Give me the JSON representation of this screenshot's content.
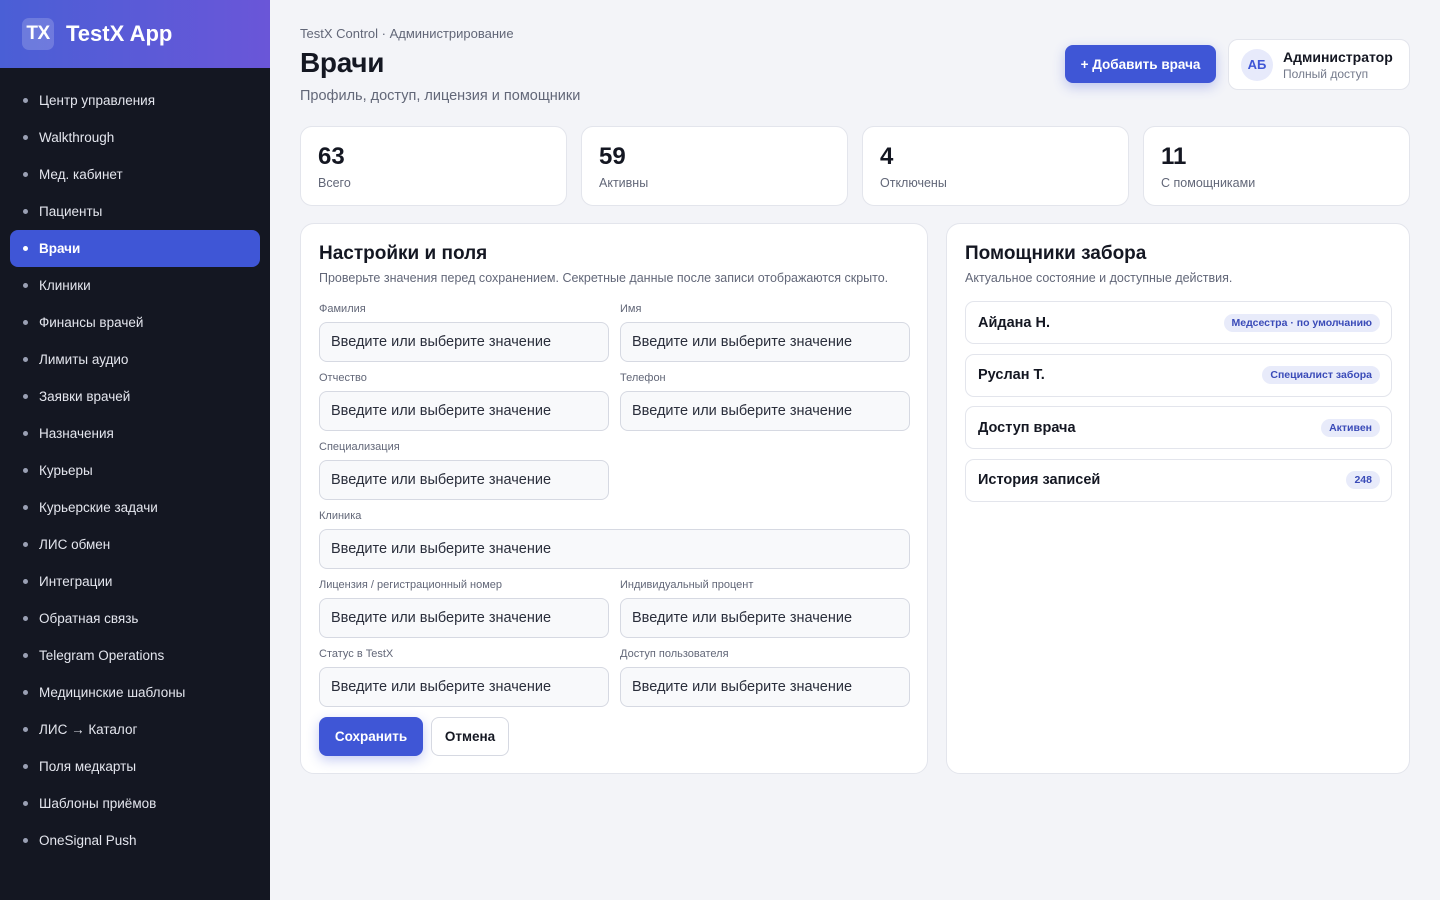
{
  "brand": {
    "logo": "TX",
    "name": "TestX App"
  },
  "sidebar": {
    "items": [
      {
        "label": "Центр управления"
      },
      {
        "label": "Walkthrough"
      },
      {
        "label": "Мед. кабинет"
      },
      {
        "label": "Пациенты"
      },
      {
        "label": "Врачи",
        "active": true
      },
      {
        "label": "Клиники"
      },
      {
        "label": "Финансы врачей"
      },
      {
        "label": "Лимиты аудио"
      },
      {
        "label": "Заявки врачей"
      },
      {
        "label": "Назначения"
      },
      {
        "label": "Курьеры"
      },
      {
        "label": "Курьерские задачи"
      },
      {
        "label": "ЛИС обмен"
      },
      {
        "label": "Интеграции"
      },
      {
        "label": "Обратная связь"
      },
      {
        "label": "Telegram Operations"
      },
      {
        "label": "Медицинские шаблоны"
      },
      {
        "label": "ЛИС → Каталог"
      },
      {
        "label": "Поля медкарты"
      },
      {
        "label": "Шаблоны приёмов"
      },
      {
        "label": "OneSignal Push"
      }
    ]
  },
  "header": {
    "breadcrumb": "TestX Control · Администрирование",
    "title": "Врачи",
    "subtitle": "Профиль, доступ, лицензия и помощники",
    "add_button": "+ Добавить врача",
    "user": {
      "initials": "АБ",
      "name": "Администратор",
      "role": "Полный доступ"
    }
  },
  "stats": [
    {
      "value": "63",
      "label": "Всего"
    },
    {
      "value": "59",
      "label": "Активны"
    },
    {
      "value": "4",
      "label": "Отключены"
    },
    {
      "value": "11",
      "label": "С помощниками"
    }
  ],
  "form": {
    "title": "Настройки и поля",
    "subtitle": "Проверьте значения перед сохранением. Секретные данные после записи отображаются скрыто.",
    "placeholder": "Введите или выберите значение",
    "fields": {
      "last_name": "Фамилия",
      "first_name": "Имя",
      "middle_name": "Отчество",
      "phone": "Телефон",
      "specialization": "Специализация",
      "clinic": "Клиника",
      "license": "Лицензия / регистрационный номер",
      "percent": "Индивидуальный процент",
      "status": "Статус в TestX",
      "user_access": "Доступ пользователя"
    },
    "save_label": "Сохранить",
    "cancel_label": "Отмена"
  },
  "helpers": {
    "title": "Помощники забора",
    "subtitle": "Актуальное состояние и доступные действия.",
    "items": [
      {
        "name": "Айдана Н.",
        "badge": "Медсестра · по умолчанию"
      },
      {
        "name": "Руслан Т.",
        "badge": "Специалист забора"
      },
      {
        "name": "Доступ врача",
        "badge": "Активен"
      },
      {
        "name": "История записей",
        "badge": "248"
      }
    ]
  },
  "colors": {
    "accent": "#3f56d6",
    "sidebar_bg": "#141722",
    "page_bg": "#f3f4f8",
    "badge_bg": "#e8ebfa"
  }
}
